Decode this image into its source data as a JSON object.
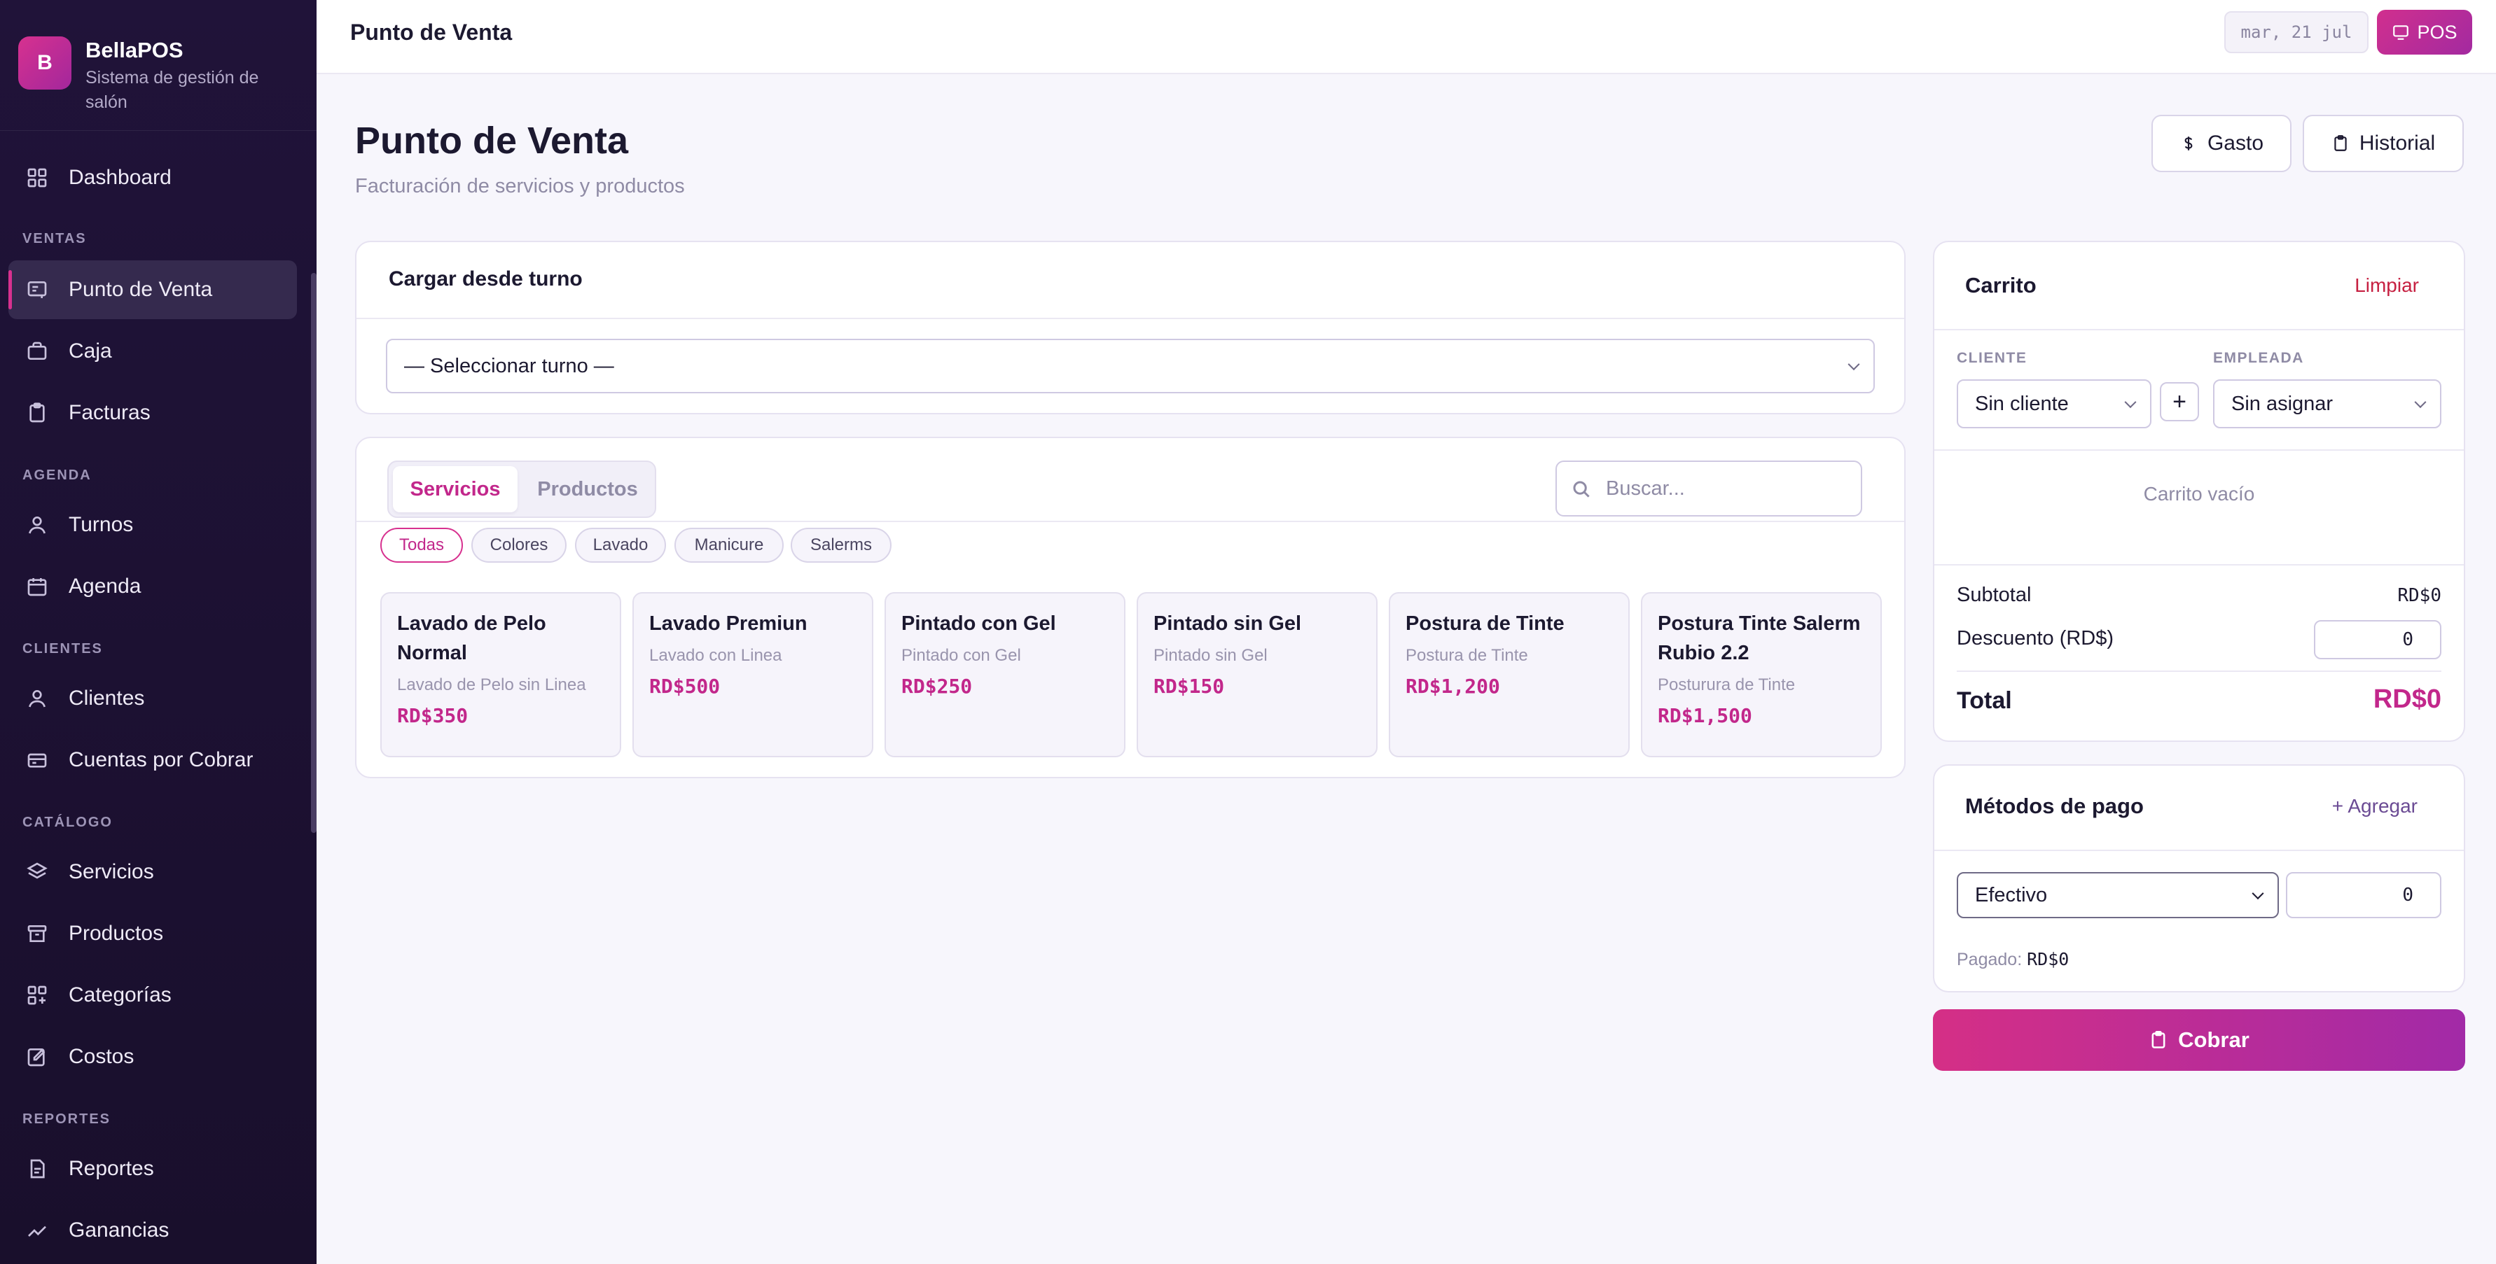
{
  "brand": {
    "logo_letter": "B",
    "name": "BellaPOS",
    "subtitle": "Sistema de gestión de salón"
  },
  "sidebar": {
    "top_item": {
      "label": "Dashboard",
      "icon": "grid-icon"
    },
    "sections": [
      {
        "title": "VENTAS",
        "items": [
          {
            "label": "Punto de Venta",
            "icon": "receipt-icon",
            "active": true
          },
          {
            "label": "Caja",
            "icon": "wallet-icon"
          },
          {
            "label": "Facturas",
            "icon": "clipboard-icon"
          }
        ]
      },
      {
        "title": "AGENDA",
        "items": [
          {
            "label": "Turnos",
            "icon": "user-icon"
          },
          {
            "label": "Agenda",
            "icon": "calendar-icon"
          }
        ]
      },
      {
        "title": "CLIENTES",
        "items": [
          {
            "label": "Clientes",
            "icon": "user-icon"
          },
          {
            "label": "Cuentas por Cobrar",
            "icon": "card-icon"
          }
        ]
      },
      {
        "title": "CATÁLOGO",
        "items": [
          {
            "label": "Servicios",
            "icon": "layers-icon"
          },
          {
            "label": "Productos",
            "icon": "archive-icon"
          },
          {
            "label": "Categorías",
            "icon": "grid-plus-icon"
          },
          {
            "label": "Costos",
            "icon": "edit-icon"
          }
        ]
      },
      {
        "title": "REPORTES",
        "items": [
          {
            "label": "Reportes",
            "icon": "document-icon"
          },
          {
            "label": "Ganancias",
            "icon": "trend-icon"
          }
        ]
      }
    ]
  },
  "topbar": {
    "title": "Punto de Venta",
    "date": "mar, 21 jul",
    "pos_label": "POS"
  },
  "page": {
    "title": "Punto de Venta",
    "subtitle": "Facturación de servicios y productos",
    "gasto_label": "Gasto",
    "historial_label": "Historial"
  },
  "turno": {
    "title": "Cargar desde turno",
    "select_value": "— Seleccionar turno —"
  },
  "catalog": {
    "tabs": [
      "Servicios",
      "Productos"
    ],
    "active_tab": "Servicios",
    "search_placeholder": "Buscar...",
    "chips": [
      "Todas",
      "Colores",
      "Lavado",
      "Manicure",
      "Salerms"
    ],
    "active_chip": "Todas",
    "services": [
      {
        "name": "Lavado de Pelo Normal",
        "desc": "Lavado de Pelo sin Linea",
        "price": "RD$350"
      },
      {
        "name": "Lavado Premiun",
        "desc": "Lavado con Linea",
        "price": "RD$500"
      },
      {
        "name": "Pintado con Gel",
        "desc": "Pintado con Gel",
        "price": "RD$250"
      },
      {
        "name": "Pintado sin Gel",
        "desc": "Pintado sin Gel",
        "price": "RD$150"
      },
      {
        "name": "Postura de Tinte",
        "desc": "Postura de Tinte",
        "price": "RD$1,200"
      },
      {
        "name": "Postura Tinte Salerm Rubio 2.2",
        "desc": "Posturura de Tinte",
        "price": "RD$1,500"
      }
    ]
  },
  "cart": {
    "title": "Carrito",
    "clear_label": "Limpiar",
    "client_label": "CLIENTE",
    "client_value": "Sin cliente",
    "add_client": "+",
    "employee_label": "EMPLEADA",
    "employee_value": "Sin asignar",
    "empty_text": "Carrito vacío",
    "subtotal_label": "Subtotal",
    "subtotal_value": "RD$0",
    "discount_label": "Descuento (RD$)",
    "discount_value": "0",
    "total_label": "Total",
    "total_value": "RD$0"
  },
  "payment": {
    "title": "Métodos de pago",
    "add_label": "+ Agregar",
    "method": "Efectivo",
    "amount": "0",
    "paid_label": "Pagado:",
    "paid_value": "RD$0"
  },
  "checkout_label": "Cobrar",
  "colors": {
    "accent": "#c2278b",
    "sidebar_bg": "#201339",
    "danger": "#c62041"
  }
}
